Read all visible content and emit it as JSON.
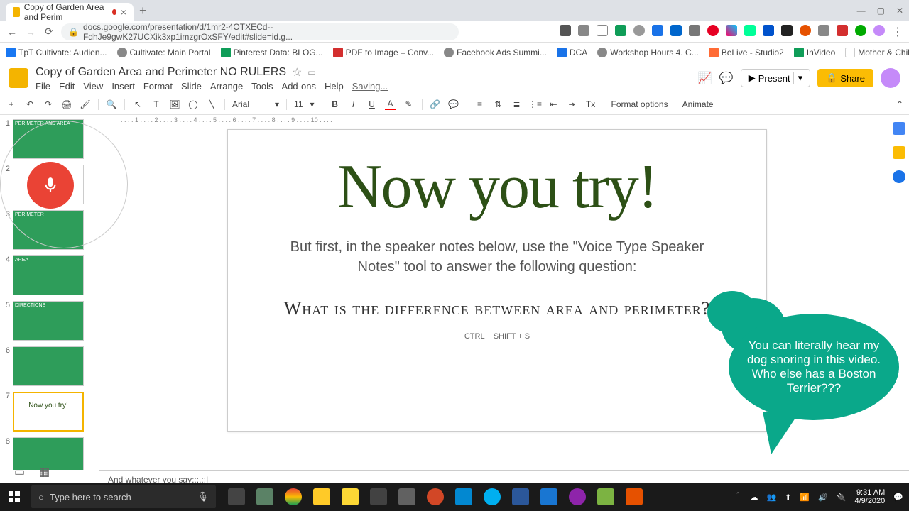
{
  "browser": {
    "tab_title": "Copy of Garden Area and Perim",
    "url": "docs.google.com/presentation/d/1mr2-4OTXECd--FdhJe9gwK27UCXik3xp1imzgrOxSFY/edit#slide=id.g...",
    "new_tab": "+",
    "close": "×",
    "window_min": "—",
    "window_max": "▢",
    "window_close": "✕"
  },
  "bookmarks": [
    "TpT Cultivate: Audien...",
    "Cultivate: Main Portal",
    "Pinterest Data: BLOG...",
    "PDF to Image – Conv...",
    "Facebook Ads Summi...",
    "DCA",
    "Workshop Hours 4. C...",
    "BeLive - Studio2",
    "InVideo",
    "Mother & Child Grad..."
  ],
  "doc": {
    "title": "Copy of Garden Area and Perimeter NO RULERS",
    "saving": "Saving...",
    "menus": [
      "File",
      "Edit",
      "View",
      "Insert",
      "Format",
      "Slide",
      "Arrange",
      "Tools",
      "Add-ons",
      "Help"
    ],
    "present": "Present",
    "share": "Share"
  },
  "toolbar": {
    "font": "Arial",
    "size": "11",
    "format_options": "Format options",
    "animate": "Animate"
  },
  "slides": [
    {
      "num": "1",
      "label": "PERIMETER AND AREA"
    },
    {
      "num": "2",
      "label": ""
    },
    {
      "num": "3",
      "label": "PERIMETER"
    },
    {
      "num": "4",
      "label": "AREA"
    },
    {
      "num": "5",
      "label": "DIRECTIONS"
    },
    {
      "num": "6",
      "label": ""
    },
    {
      "num": "7",
      "label": "Now you try!"
    },
    {
      "num": "8",
      "label": ""
    }
  ],
  "slide_content": {
    "title": "Now you try!",
    "body": "But first, in the speaker notes below, use the \"Voice Type Speaker Notes\" tool to answer the following question:",
    "question": "What is the difference between area and perimeter?",
    "shortcut": "CTRL + SHIFT + S"
  },
  "speaker_notes": "And whatever you say:::.::|",
  "bubble": "You can literally hear my dog snoring in this video.  Who else has a Boston Terrier???",
  "taskbar": {
    "search_placeholder": "Type here to search",
    "time": "9:31 AM",
    "date": "4/9/2020"
  }
}
